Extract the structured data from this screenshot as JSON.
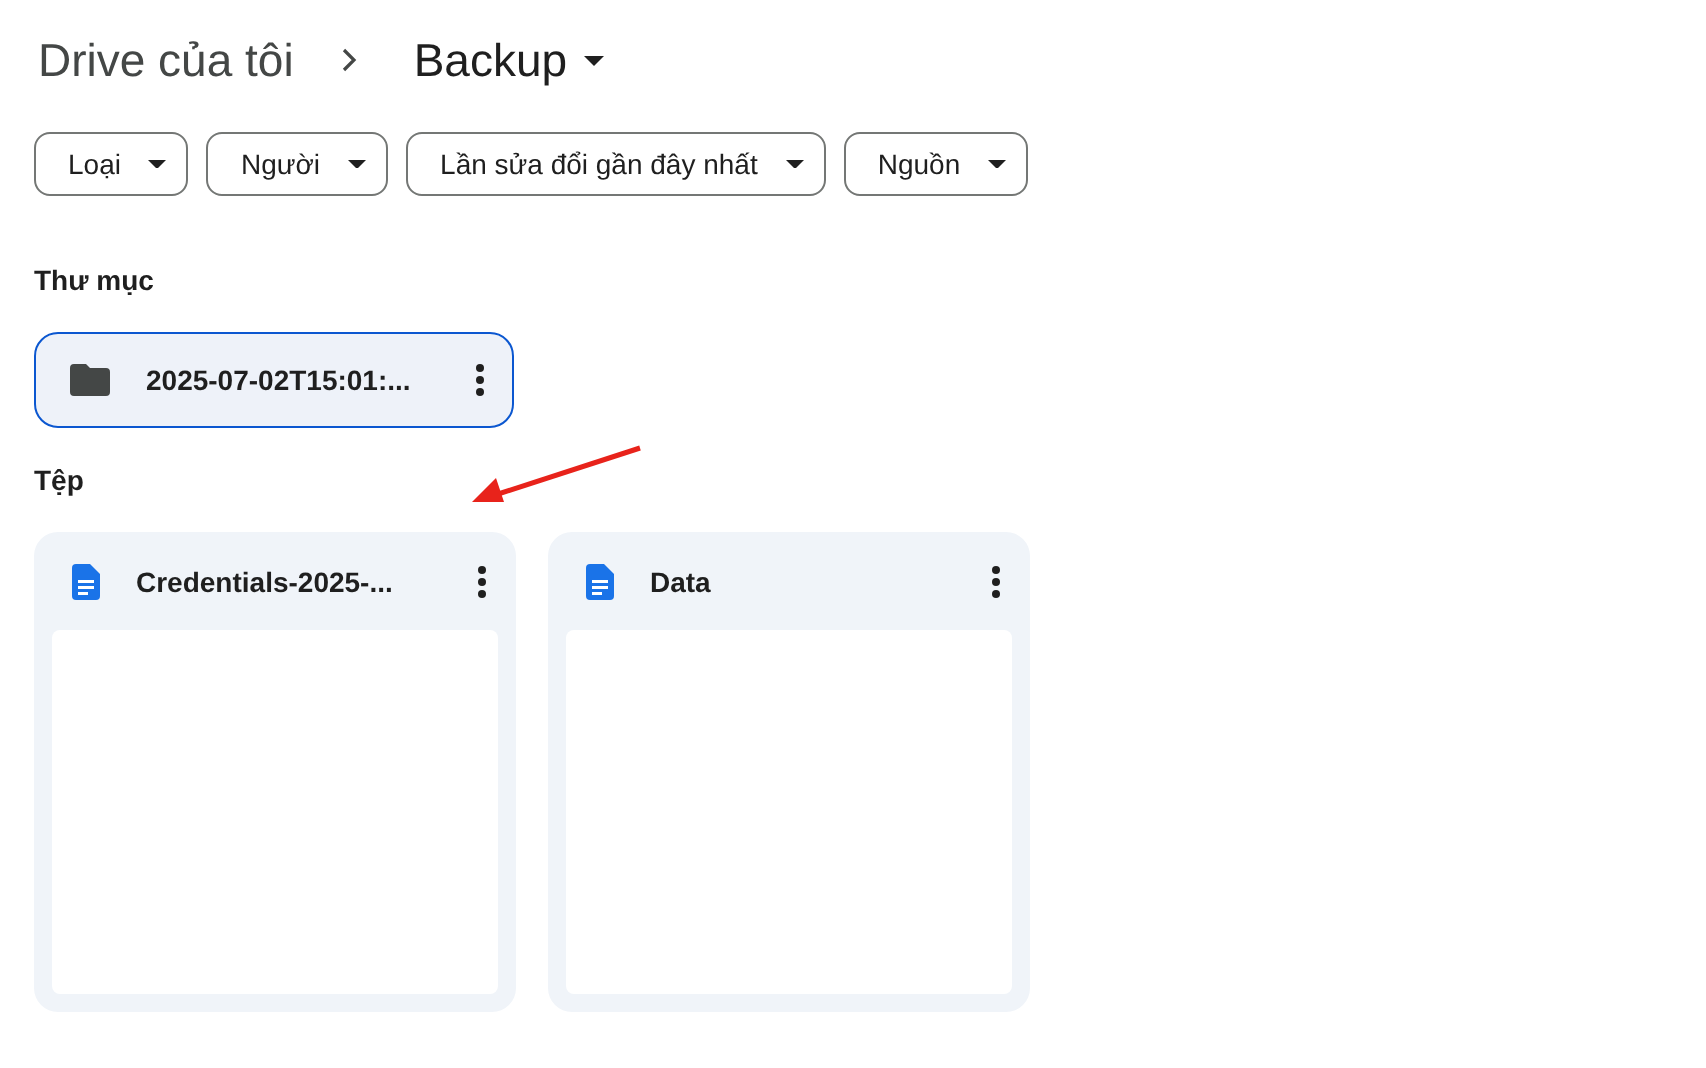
{
  "breadcrumb": [
    {
      "label": "Drive của tôi",
      "current": false
    },
    {
      "label": "Backup",
      "current": true
    }
  ],
  "filters": [
    {
      "label": "Loại"
    },
    {
      "label": "Người"
    },
    {
      "label": "Lần sửa đổi gần đây nhất"
    },
    {
      "label": "Nguồn"
    }
  ],
  "folders_section": {
    "title": "Thư mục",
    "items": [
      {
        "name": "2025-07-02T15:01:...",
        "selected": true
      }
    ]
  },
  "files_section": {
    "title": "Tệp",
    "items": [
      {
        "name": "Credentials-2025-...",
        "selected": false
      },
      {
        "name": "Data",
        "selected": false
      }
    ]
  }
}
